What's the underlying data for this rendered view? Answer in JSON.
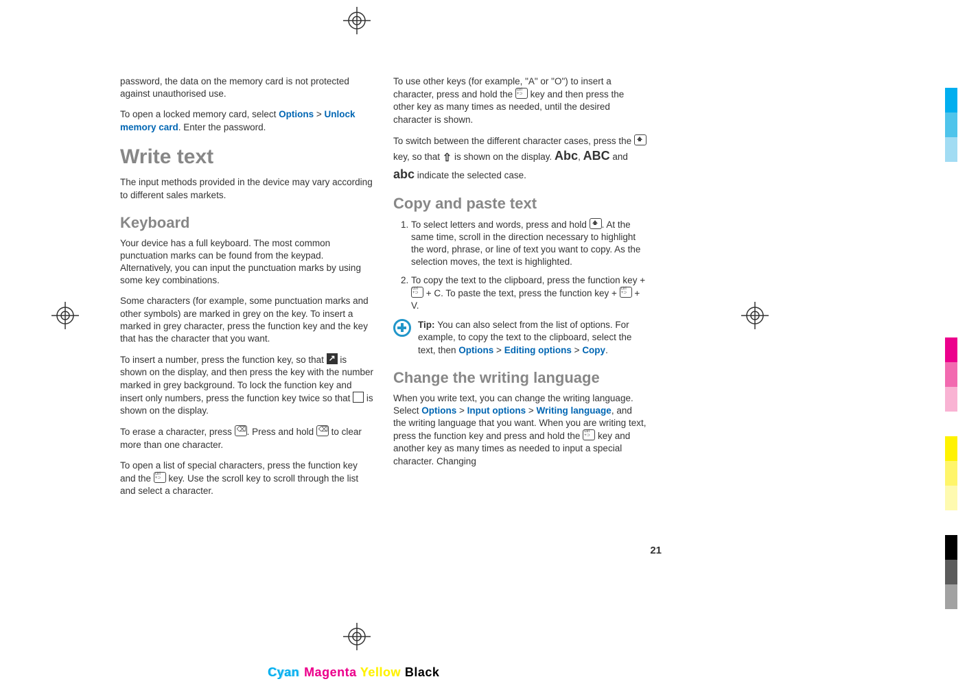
{
  "page_number": "21",
  "left": {
    "p1": "password, the data on the memory card is not protected against unauthorised use.",
    "p2_a": "To open a locked memory card, select ",
    "p2_link1": "Options",
    "p2_gt": " > ",
    "p2_link2": "Unlock memory card",
    "p2_b": ". Enter the password.",
    "h1": "Write text",
    "p3": "The input methods provided in the device may vary according to different sales markets.",
    "h2": "Keyboard",
    "p4": "Your device has a full keyboard. The most common punctuation marks can be found from the keypad. Alternatively, you can input the punctuation marks by using some key combinations.",
    "p5": "Some characters (for example, some punctuation marks and other symbols) are marked in grey on the key. To insert a marked in grey character, press the function key and the key that has the character that you want.",
    "p6_a": "To insert a number, press the function key, so that ",
    "p6_b": " is shown on the display, and then press the key with the number marked in grey background. To lock the function key and insert only numbers, press the function key twice so that ",
    "p6_c": " is shown on the display.",
    "p7_a": "To erase a character, press ",
    "p7_b": ". Press and hold ",
    "p7_c": " to clear more than one character.",
    "p8_a": "To open a list of special characters, press the function key and the ",
    "p8_b": " key. Use the scroll key to scroll through the list and select a character."
  },
  "right": {
    "p1_a": "To use other keys (for example, \"A\" or \"O\") to insert a character, press and hold the ",
    "p1_b": " key and then press the other key as many times as needed, until the desired character is shown.",
    "p2_a": "To switch between the different character cases, press the ",
    "p2_b": " key, so that ",
    "p2_c": " is shown on the display. ",
    "case1": "Abc",
    "case_sep1": ", ",
    "case2": "ABC",
    "case_and": " and ",
    "case3": "abc",
    "case_tail": " indicate the selected case.",
    "h2a": "Copy and paste text",
    "li1_a": "To select letters and words, press and hold ",
    "li1_b": ". At the same time, scroll in the direction necessary to highlight the word, phrase, or line of text you want to copy. As the selection moves, the text is highlighted.",
    "li2_a": "To copy the text to the clipboard, press the function key + ",
    "li2_b": " + C. To paste the text, press the function key + ",
    "li2_c": " + V.",
    "tip_label": "Tip:  ",
    "tip_a": "You can also select from the list of options. For example, to copy the text to the clipboard, select the text, then ",
    "tip_link1": "Options",
    "tip_gt1": " > ",
    "tip_link2": "Editing options",
    "tip_gt2": " > ",
    "tip_link3": "Copy",
    "tip_period": ".",
    "h2b": "Change the writing language",
    "p3_a": "When you write text, you can change the writing language. Select ",
    "p3_link1": "Options",
    "p3_gt1": " > ",
    "p3_link2": " Input options",
    "p3_gt2": " > ",
    "p3_link3": "Writing language",
    "p3_b": ", and the writing language that you want. When you are writing text, press the function key and press and hold the ",
    "p3_c": " key and another key as many times as needed to input a special character. Changing"
  },
  "footer": {
    "cyan": "Cyan",
    "magenta": "Magenta",
    "yellow": "Yellow",
    "black": "Black"
  },
  "colors": {
    "strip1": [
      "#ffffff",
      "#ffffff",
      "#00aeef",
      "#4fc4eb",
      "#a2dcf3"
    ],
    "strip2": [
      "#ec008c",
      "#f26ab0",
      "#f9b3d3",
      "#ffffff",
      "#fff200",
      "#fff56a",
      "#fefab0",
      "#ffffff",
      "#000000",
      "#5b5b5b",
      "#a2a2a2"
    ]
  }
}
